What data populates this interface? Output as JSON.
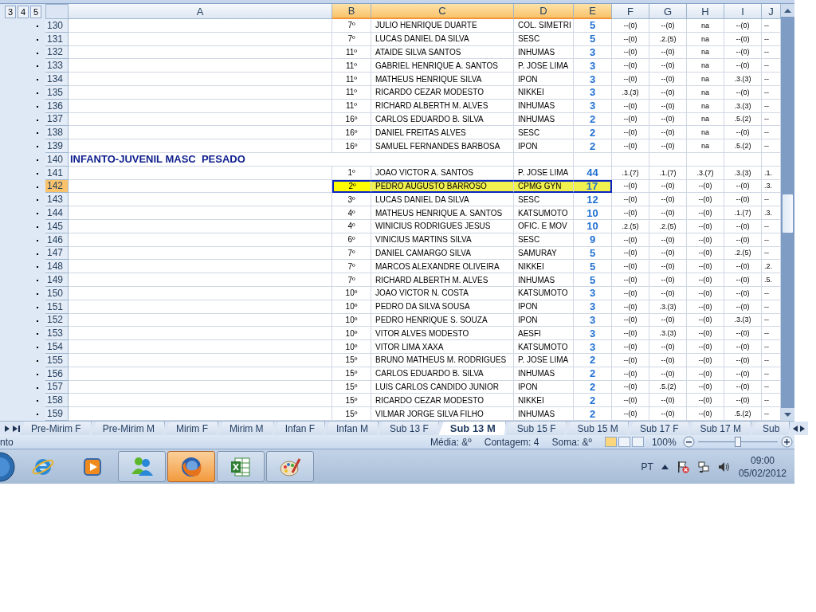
{
  "outline_levels": [
    "3",
    "4",
    "5"
  ],
  "columns": [
    {
      "label": "A",
      "selected": false
    },
    {
      "label": "B",
      "selected": true
    },
    {
      "label": "C",
      "selected": true
    },
    {
      "label": "D",
      "selected": true
    },
    {
      "label": "E",
      "selected": true
    },
    {
      "label": "F",
      "selected": false
    },
    {
      "label": "G",
      "selected": false
    },
    {
      "label": "H",
      "selected": false
    },
    {
      "label": "I",
      "selected": false
    },
    {
      "label": "J",
      "selected": false
    }
  ],
  "rows": [
    {
      "number": "130",
      "kind": "data",
      "selected": false,
      "cells": [
        "7º",
        "JULIO HENRIQUE DUARTE",
        "COL. SIMETRI",
        "5",
        "--(0)",
        "--(0)",
        "na",
        "--(0)",
        "--"
      ]
    },
    {
      "number": "131",
      "kind": "data",
      "selected": false,
      "cells": [
        "7º",
        "LUCAS DANIEL DA SILVA",
        "SESC",
        "5",
        "--(0)",
        ".2.(5)",
        "na",
        "--(0)",
        "--"
      ]
    },
    {
      "number": "132",
      "kind": "data",
      "selected": false,
      "cells": [
        "11º",
        "ATAIDE SILVA SANTOS",
        "INHUMAS",
        "3",
        "--(0)",
        "--(0)",
        "na",
        "--(0)",
        "--"
      ]
    },
    {
      "number": "133",
      "kind": "data",
      "selected": false,
      "cells": [
        "11º",
        "GABRIEL HENRIQUE A. SANTOS",
        "P. JOSE LIMA",
        "3",
        "--(0)",
        "--(0)",
        "na",
        "--(0)",
        "--"
      ]
    },
    {
      "number": "134",
      "kind": "data",
      "selected": false,
      "cells": [
        "11º",
        "MATHEUS HENRIQUE SILVA",
        "IPON",
        "3",
        "--(0)",
        "--(0)",
        "na",
        ".3.(3)",
        "--"
      ]
    },
    {
      "number": "135",
      "kind": "data",
      "selected": false,
      "cells": [
        "11º",
        "RICARDO CEZAR MODESTO",
        "NIKKEI",
        "3",
        ".3.(3)",
        "--(0)",
        "na",
        "--(0)",
        "--"
      ]
    },
    {
      "number": "136",
      "kind": "data",
      "selected": false,
      "cells": [
        "11º",
        "RICHARD ALBERTH M. ALVES",
        "INHUMAS",
        "3",
        "--(0)",
        "--(0)",
        "na",
        ".3.(3)",
        "--"
      ]
    },
    {
      "number": "137",
      "kind": "data",
      "selected": false,
      "cells": [
        "16º",
        "CARLOS EDUARDO B. SILVA",
        "INHUMAS",
        "2",
        "--(0)",
        "--(0)",
        "na",
        ".5.(2)",
        "--"
      ]
    },
    {
      "number": "138",
      "kind": "data",
      "selected": false,
      "cells": [
        "16º",
        "DANIEL FREITAS ALVES",
        "SESC",
        "2",
        "--(0)",
        "--(0)",
        "na",
        "--(0)",
        "--"
      ]
    },
    {
      "number": "139",
      "kind": "data",
      "selected": false,
      "cells": [
        "16º",
        "SAMUEL FERNANDES BARBOSA",
        "IPON",
        "2",
        "--(0)",
        "--(0)",
        "na",
        ".5.(2)",
        "--"
      ]
    },
    {
      "number": "140",
      "kind": "title",
      "selected": false,
      "title": "INFANTO-JUVENIL MASC  PESADO"
    },
    {
      "number": "141",
      "kind": "data",
      "selected": false,
      "cells": [
        "1º",
        "JOAO VICTOR A. SANTOS",
        "P. JOSE LIMA",
        "44",
        ".1.(7)",
        ".1.(7)",
        ".3.(7)",
        ".3.(3)",
        ".1."
      ]
    },
    {
      "number": "142",
      "kind": "data",
      "selected": true,
      "cells": [
        "2º",
        "PEDRO AUGUSTO BARROSO",
        "CPMG GYN",
        "17",
        "--(0)",
        "--(0)",
        "--(0)",
        "--(0)",
        ".3."
      ]
    },
    {
      "number": "143",
      "kind": "data",
      "selected": false,
      "cells": [
        "3º",
        "LUCAS DANIEL DA SILVA",
        "SESC",
        "12",
        "--(0)",
        "--(0)",
        "--(0)",
        "--(0)",
        "--"
      ]
    },
    {
      "number": "144",
      "kind": "data",
      "selected": false,
      "cells": [
        "4º",
        "MATHEUS HENRIQUE A. SANTOS",
        "KATSUMOTO",
        "10",
        "--(0)",
        "--(0)",
        "--(0)",
        ".1.(7)",
        ".3."
      ]
    },
    {
      "number": "145",
      "kind": "data",
      "selected": false,
      "cells": [
        "4º",
        "WINICIUS RODRIGUES JESUS",
        "OFIC. E MOV",
        "10",
        ".2.(5)",
        ".2.(5)",
        "--(0)",
        "--(0)",
        "--"
      ]
    },
    {
      "number": "146",
      "kind": "data",
      "selected": false,
      "cells": [
        "6º",
        "VINICIUS MARTINS SILVA",
        "SESC",
        "9",
        "--(0)",
        "--(0)",
        "--(0)",
        "--(0)",
        "--"
      ]
    },
    {
      "number": "147",
      "kind": "data",
      "selected": false,
      "cells": [
        "7º",
        "DANIEL CAMARGO SILVA",
        "SAMURAY",
        "5",
        "--(0)",
        "--(0)",
        "--(0)",
        ".2.(5)",
        "--"
      ]
    },
    {
      "number": "148",
      "kind": "data",
      "selected": false,
      "cells": [
        "7º",
        "MARCOS ALEXANDRE OLIVEIRA",
        "NIKKEI",
        "5",
        "--(0)",
        "--(0)",
        "--(0)",
        "--(0)",
        ".2."
      ]
    },
    {
      "number": "149",
      "kind": "data",
      "selected": false,
      "cells": [
        "7º",
        "RICHARD ALBERTH M. ALVES",
        "INHUMAS",
        "5",
        "--(0)",
        "--(0)",
        "--(0)",
        "--(0)",
        ".5."
      ]
    },
    {
      "number": "150",
      "kind": "data",
      "selected": false,
      "cells": [
        "10º",
        "JOAO VICTOR N. COSTA",
        "KATSUMOTO",
        "3",
        "--(0)",
        "--(0)",
        "--(0)",
        "--(0)",
        "--"
      ]
    },
    {
      "number": "151",
      "kind": "data",
      "selected": false,
      "cells": [
        "10º",
        "PEDRO DA SILVA SOUSA",
        "IPON",
        "3",
        "--(0)",
        ".3.(3)",
        "--(0)",
        "--(0)",
        "--"
      ]
    },
    {
      "number": "152",
      "kind": "data",
      "selected": false,
      "cells": [
        "10º",
        "PEDRO HENRIQUE S. SOUZA",
        "IPON",
        "3",
        "--(0)",
        "--(0)",
        "--(0)",
        ".3.(3)",
        "--"
      ]
    },
    {
      "number": "153",
      "kind": "data",
      "selected": false,
      "cells": [
        "10º",
        "VITOR ALVES MODESTO",
        "AESFI",
        "3",
        "--(0)",
        ".3.(3)",
        "--(0)",
        "--(0)",
        "--"
      ]
    },
    {
      "number": "154",
      "kind": "data",
      "selected": false,
      "cells": [
        "10º",
        "VITOR LIMA XAXA",
        "KATSUMOTO",
        "3",
        "--(0)",
        "--(0)",
        "--(0)",
        "--(0)",
        "--"
      ]
    },
    {
      "number": "155",
      "kind": "data",
      "selected": false,
      "cells": [
        "15º",
        "BRUNO MATHEUS M. RODRIGUES",
        "P. JOSE LIMA",
        "2",
        "--(0)",
        "--(0)",
        "--(0)",
        "--(0)",
        "--"
      ]
    },
    {
      "number": "156",
      "kind": "data",
      "selected": false,
      "cells": [
        "15º",
        "CARLOS EDUARDO B. SILVA",
        "INHUMAS",
        "2",
        "--(0)",
        "--(0)",
        "--(0)",
        "--(0)",
        "--"
      ]
    },
    {
      "number": "157",
      "kind": "data",
      "selected": false,
      "cells": [
        "15º",
        "LUIS CARLOS CANDIDO JUNIOR",
        "IPON",
        "2",
        "--(0)",
        ".5.(2)",
        "--(0)",
        "--(0)",
        "--"
      ]
    },
    {
      "number": "158",
      "kind": "data",
      "selected": false,
      "cells": [
        "15º",
        "RICARDO CEZAR MODESTO",
        "NIKKEI",
        "2",
        "--(0)",
        "--(0)",
        "--(0)",
        "--(0)",
        "--"
      ]
    },
    {
      "number": "159",
      "kind": "data",
      "selected": false,
      "cells": [
        "15º",
        "VILMAR JORGE SILVA FILHO",
        "INHUMAS",
        "2",
        "--(0)",
        "--(0)",
        "--(0)",
        ".5.(2)",
        "--"
      ]
    }
  ],
  "sheet_tabs": [
    {
      "label": "Pre-Mirim F",
      "selected": false
    },
    {
      "label": "Pre-Mirim M",
      "selected": false
    },
    {
      "label": "Mirim F",
      "selected": false
    },
    {
      "label": "Mirim M",
      "selected": false
    },
    {
      "label": "Infan F",
      "selected": false
    },
    {
      "label": "Infan M",
      "selected": false
    },
    {
      "label": "Sub 13 F",
      "selected": false
    },
    {
      "label": "Sub 13 M",
      "selected": true
    },
    {
      "label": "Sub 15 F",
      "selected": false
    },
    {
      "label": "Sub 15 M",
      "selected": false
    },
    {
      "label": "Sub 17 F",
      "selected": false
    },
    {
      "label": "Sub 17 M",
      "selected": false
    },
    {
      "label": "Sub",
      "selected": false
    }
  ],
  "status_bar": {
    "state": "nto",
    "average": "Média: &º",
    "count": "Contagem: 4",
    "sum": "Soma: &º",
    "zoom": "100%",
    "zoom_slider": {
      "level": 0.5
    }
  },
  "taskbar": {
    "apps": [
      {
        "kind": "browser",
        "active": false
      },
      {
        "kind": "media",
        "active": false
      },
      {
        "kind": "messenger",
        "active": false
      },
      {
        "kind": "firefox",
        "active": true
      },
      {
        "kind": "excel",
        "active": false
      },
      {
        "kind": "paint",
        "active": false
      }
    ],
    "language": "PT",
    "time": "09:00",
    "date": "05/02/2012"
  }
}
